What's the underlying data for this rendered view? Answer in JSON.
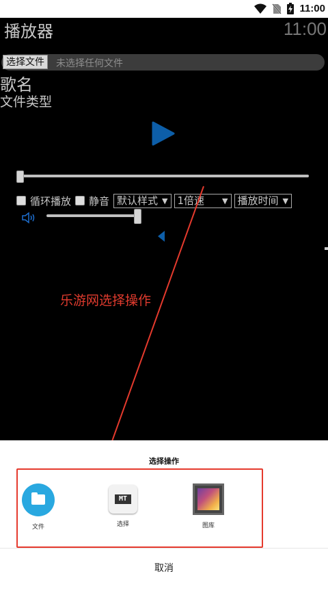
{
  "status_bar": {
    "time": "11:00"
  },
  "app": {
    "title": "播放器",
    "clock": "11:00"
  },
  "file_picker": {
    "button_label": "选择文件",
    "status": "未选择任何文件"
  },
  "track": {
    "song_name": "歌名",
    "file_type": "文件类型"
  },
  "controls": {
    "loop_label": "循环播放",
    "mute_label": "静音",
    "style_select": "默认样式",
    "speed_select": "1倍速",
    "time_select": "播放时间"
  },
  "annotation": {
    "text": "乐游网选择操作",
    "color": "#e03b2e"
  },
  "sheet": {
    "title": "选择操作",
    "options": [
      {
        "label": "文件",
        "icon": "folder-icon"
      },
      {
        "label": "选择",
        "icon": "mt-manager-icon"
      },
      {
        "label": "图库",
        "icon": "gallery-icon"
      }
    ],
    "cancel_label": "取消"
  }
}
